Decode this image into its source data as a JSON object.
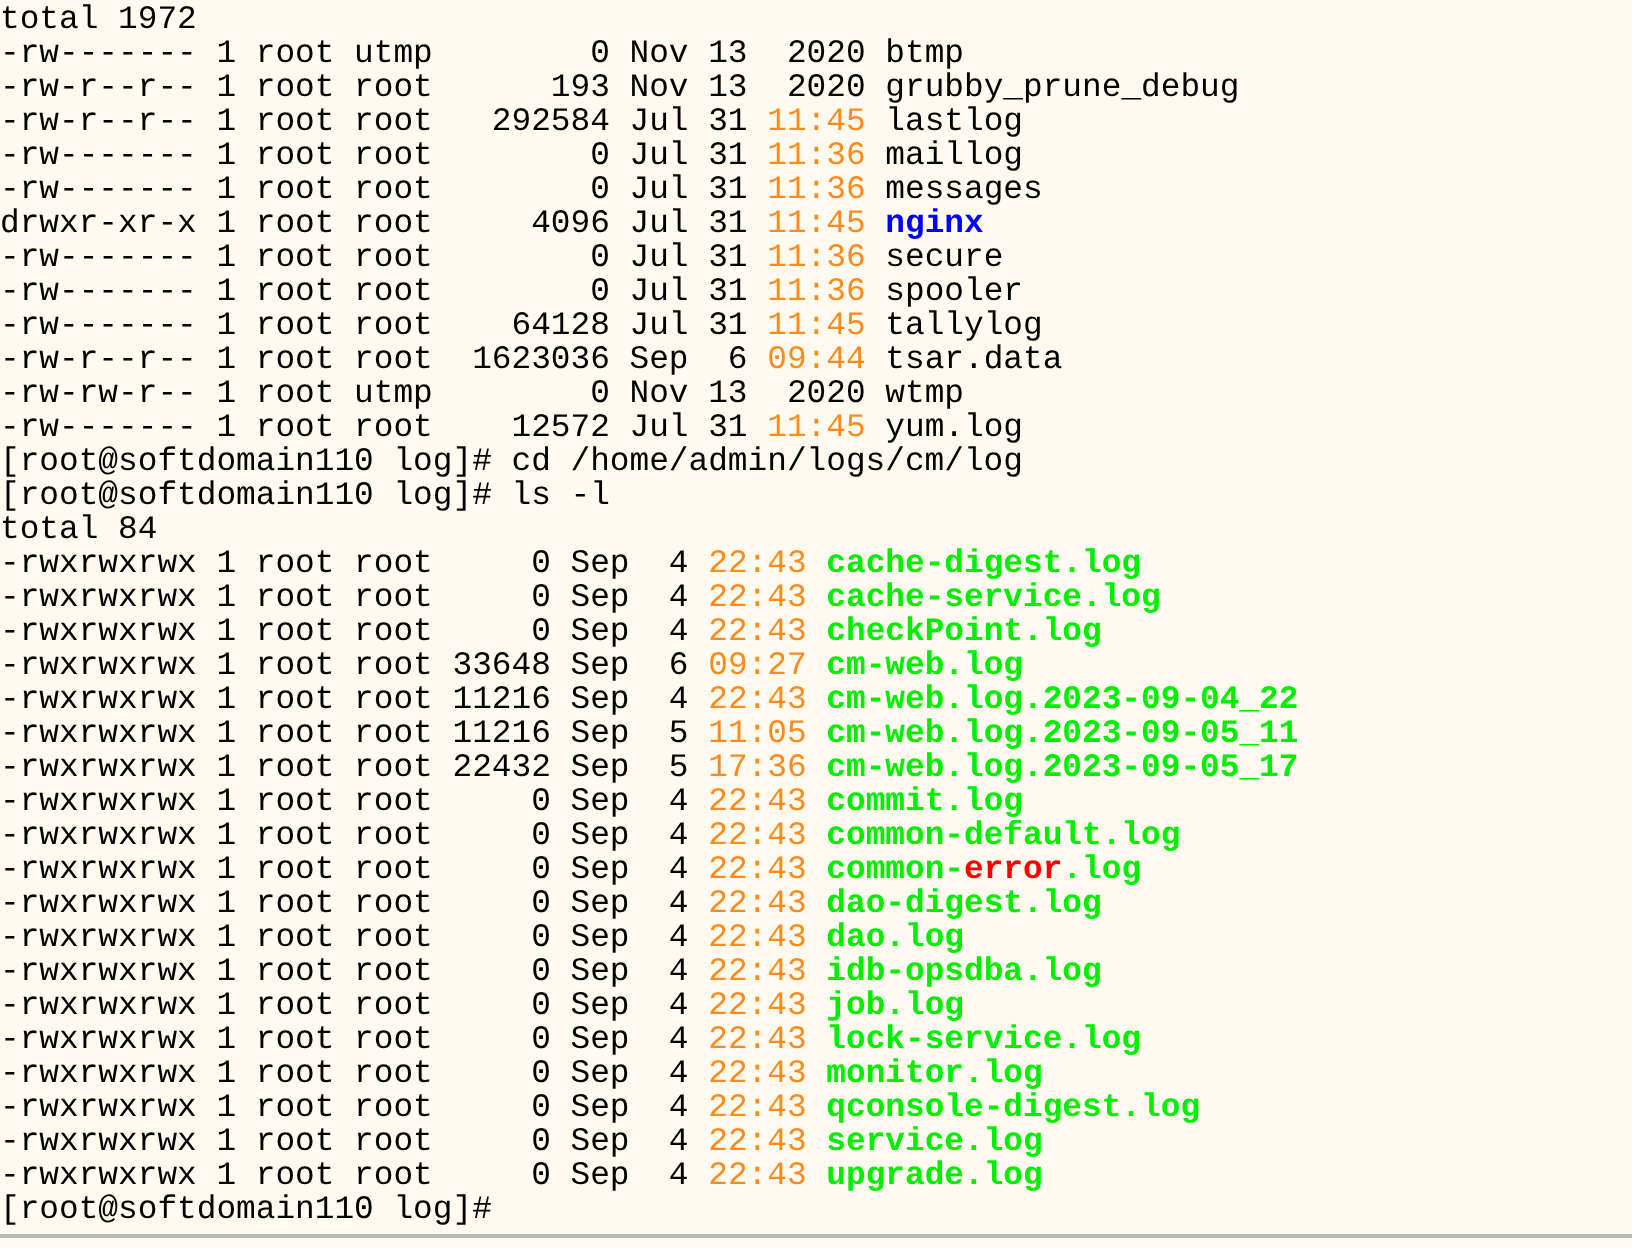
{
  "terminal": {
    "lines": [
      {
        "kind": "output",
        "text": "total 1972"
      },
      {
        "kind": "file",
        "meta": "-rw------- 1 root utmp        0 Nov 13",
        "time": {
          "text": " 2020",
          "recent": false
        },
        "name": {
          "kind": "plain",
          "parts": [
            {
              "text": "btmp",
              "highlight": false
            }
          ]
        }
      },
      {
        "kind": "file",
        "meta": "-rw-r--r-- 1 root root      193 Nov 13",
        "time": {
          "text": " 2020",
          "recent": false
        },
        "name": {
          "kind": "plain",
          "parts": [
            {
              "text": "grubby_prune_debug",
              "highlight": false
            }
          ]
        }
      },
      {
        "kind": "file",
        "meta": "-rw-r--r-- 1 root root   292584 Jul 31",
        "time": {
          "text": "11:45",
          "recent": true
        },
        "name": {
          "kind": "plain",
          "parts": [
            {
              "text": "lastlog",
              "highlight": false
            }
          ]
        }
      },
      {
        "kind": "file",
        "meta": "-rw------- 1 root root        0 Jul 31",
        "time": {
          "text": "11:36",
          "recent": true
        },
        "name": {
          "kind": "plain",
          "parts": [
            {
              "text": "maillog",
              "highlight": false
            }
          ]
        }
      },
      {
        "kind": "file",
        "meta": "-rw------- 1 root root        0 Jul 31",
        "time": {
          "text": "11:36",
          "recent": true
        },
        "name": {
          "kind": "plain",
          "parts": [
            {
              "text": "messages",
              "highlight": false
            }
          ]
        }
      },
      {
        "kind": "file",
        "meta": "drwxr-xr-x 1 root root     4096 Jul 31",
        "time": {
          "text": "11:45",
          "recent": true
        },
        "name": {
          "kind": "directory",
          "parts": [
            {
              "text": "nginx",
              "highlight": false
            }
          ]
        }
      },
      {
        "kind": "file",
        "meta": "-rw------- 1 root root        0 Jul 31",
        "time": {
          "text": "11:36",
          "recent": true
        },
        "name": {
          "kind": "plain",
          "parts": [
            {
              "text": "secure",
              "highlight": false
            }
          ]
        }
      },
      {
        "kind": "file",
        "meta": "-rw------- 1 root root        0 Jul 31",
        "time": {
          "text": "11:36",
          "recent": true
        },
        "name": {
          "kind": "plain",
          "parts": [
            {
              "text": "spooler",
              "highlight": false
            }
          ]
        }
      },
      {
        "kind": "file",
        "meta": "-rw------- 1 root root    64128 Jul 31",
        "time": {
          "text": "11:45",
          "recent": true
        },
        "name": {
          "kind": "plain",
          "parts": [
            {
              "text": "tallylog",
              "highlight": false
            }
          ]
        }
      },
      {
        "kind": "file",
        "meta": "-rw-r--r-- 1 root root  1623036 Sep  6",
        "time": {
          "text": "09:44",
          "recent": true
        },
        "name": {
          "kind": "plain",
          "parts": [
            {
              "text": "tsar.data",
              "highlight": false
            }
          ]
        }
      },
      {
        "kind": "file",
        "meta": "-rw-rw-r-- 1 root utmp        0 Nov 13",
        "time": {
          "text": " 2020",
          "recent": false
        },
        "name": {
          "kind": "plain",
          "parts": [
            {
              "text": "wtmp",
              "highlight": false
            }
          ]
        }
      },
      {
        "kind": "file",
        "meta": "-rw------- 1 root root    12572 Jul 31",
        "time": {
          "text": "11:45",
          "recent": true
        },
        "name": {
          "kind": "plain",
          "parts": [
            {
              "text": "yum.log",
              "highlight": false
            }
          ]
        }
      },
      {
        "kind": "prompt",
        "text": "[root@softdomain110 log]# cd /home/admin/logs/cm/log"
      },
      {
        "kind": "prompt",
        "text": "[root@softdomain110 log]# ls -l"
      },
      {
        "kind": "output",
        "text": "total 84"
      },
      {
        "kind": "file",
        "meta": "-rwxrwxrwx 1 root root     0 Sep  4",
        "time": {
          "text": "22:43",
          "recent": true
        },
        "name": {
          "kind": "executable",
          "parts": [
            {
              "text": "cache-digest.log",
              "highlight": false
            }
          ]
        }
      },
      {
        "kind": "file",
        "meta": "-rwxrwxrwx 1 root root     0 Sep  4",
        "time": {
          "text": "22:43",
          "recent": true
        },
        "name": {
          "kind": "executable",
          "parts": [
            {
              "text": "cache-service.log",
              "highlight": false
            }
          ]
        }
      },
      {
        "kind": "file",
        "meta": "-rwxrwxrwx 1 root root     0 Sep  4",
        "time": {
          "text": "22:43",
          "recent": true
        },
        "name": {
          "kind": "executable",
          "parts": [
            {
              "text": "checkPoint.log",
              "highlight": false
            }
          ]
        }
      },
      {
        "kind": "file",
        "meta": "-rwxrwxrwx 1 root root 33648 Sep  6",
        "time": {
          "text": "09:27",
          "recent": true
        },
        "name": {
          "kind": "executable",
          "parts": [
            {
              "text": "cm-web.log",
              "highlight": false
            }
          ]
        }
      },
      {
        "kind": "file",
        "meta": "-rwxrwxrwx 1 root root 11216 Sep  4",
        "time": {
          "text": "22:43",
          "recent": true
        },
        "name": {
          "kind": "executable",
          "parts": [
            {
              "text": "cm-web.log.2023-09-04_22",
              "highlight": false
            }
          ]
        }
      },
      {
        "kind": "file",
        "meta": "-rwxrwxrwx 1 root root 11216 Sep  5",
        "time": {
          "text": "11:05",
          "recent": true
        },
        "name": {
          "kind": "executable",
          "parts": [
            {
              "text": "cm-web.log.2023-09-05_11",
              "highlight": false
            }
          ]
        }
      },
      {
        "kind": "file",
        "meta": "-rwxrwxrwx 1 root root 22432 Sep  5",
        "time": {
          "text": "17:36",
          "recent": true
        },
        "name": {
          "kind": "executable",
          "parts": [
            {
              "text": "cm-web.log.2023-09-05_17",
              "highlight": false
            }
          ]
        }
      },
      {
        "kind": "file",
        "meta": "-rwxrwxrwx 1 root root     0 Sep  4",
        "time": {
          "text": "22:43",
          "recent": true
        },
        "name": {
          "kind": "executable",
          "parts": [
            {
              "text": "commit.log",
              "highlight": false
            }
          ]
        }
      },
      {
        "kind": "file",
        "meta": "-rwxrwxrwx 1 root root     0 Sep  4",
        "time": {
          "text": "22:43",
          "recent": true
        },
        "name": {
          "kind": "executable",
          "parts": [
            {
              "text": "common-default.log",
              "highlight": false
            }
          ]
        }
      },
      {
        "kind": "file",
        "meta": "-rwxrwxrwx 1 root root     0 Sep  4",
        "time": {
          "text": "22:43",
          "recent": true
        },
        "name": {
          "kind": "executable",
          "parts": [
            {
              "text": "common-",
              "highlight": false
            },
            {
              "text": "error",
              "highlight": true
            },
            {
              "text": ".log",
              "highlight": false
            }
          ]
        }
      },
      {
        "kind": "file",
        "meta": "-rwxrwxrwx 1 root root     0 Sep  4",
        "time": {
          "text": "22:43",
          "recent": true
        },
        "name": {
          "kind": "executable",
          "parts": [
            {
              "text": "dao-digest.log",
              "highlight": false
            }
          ]
        }
      },
      {
        "kind": "file",
        "meta": "-rwxrwxrwx 1 root root     0 Sep  4",
        "time": {
          "text": "22:43",
          "recent": true
        },
        "name": {
          "kind": "executable",
          "parts": [
            {
              "text": "dao.log",
              "highlight": false
            }
          ]
        }
      },
      {
        "kind": "file",
        "meta": "-rwxrwxrwx 1 root root     0 Sep  4",
        "time": {
          "text": "22:43",
          "recent": true
        },
        "name": {
          "kind": "executable",
          "parts": [
            {
              "text": "idb-opsdba.log",
              "highlight": false
            }
          ]
        }
      },
      {
        "kind": "file",
        "meta": "-rwxrwxrwx 1 root root     0 Sep  4",
        "time": {
          "text": "22:43",
          "recent": true
        },
        "name": {
          "kind": "executable",
          "parts": [
            {
              "text": "job.log",
              "highlight": false
            }
          ]
        }
      },
      {
        "kind": "file",
        "meta": "-rwxrwxrwx 1 root root     0 Sep  4",
        "time": {
          "text": "22:43",
          "recent": true
        },
        "name": {
          "kind": "executable",
          "parts": [
            {
              "text": "lock-service.log",
              "highlight": false
            }
          ]
        }
      },
      {
        "kind": "file",
        "meta": "-rwxrwxrwx 1 root root     0 Sep  4",
        "time": {
          "text": "22:43",
          "recent": true
        },
        "name": {
          "kind": "executable",
          "parts": [
            {
              "text": "monitor.log",
              "highlight": false
            }
          ]
        }
      },
      {
        "kind": "file",
        "meta": "-rwxrwxrwx 1 root root     0 Sep  4",
        "time": {
          "text": "22:43",
          "recent": true
        },
        "name": {
          "kind": "executable",
          "parts": [
            {
              "text": "qconsole-digest.log",
              "highlight": false
            }
          ]
        }
      },
      {
        "kind": "file",
        "meta": "-rwxrwxrwx 1 root root     0 Sep  4",
        "time": {
          "text": "22:43",
          "recent": true
        },
        "name": {
          "kind": "executable",
          "parts": [
            {
              "text": "service.log",
              "highlight": false
            }
          ]
        }
      },
      {
        "kind": "file",
        "meta": "-rwxrwxrwx 1 root root     0 Sep  4",
        "time": {
          "text": "22:43",
          "recent": true
        },
        "name": {
          "kind": "executable",
          "parts": [
            {
              "text": "upgrade.log",
              "highlight": false
            }
          ]
        }
      },
      {
        "kind": "prompt",
        "text": "[root@softdomain110 log]#"
      }
    ]
  }
}
